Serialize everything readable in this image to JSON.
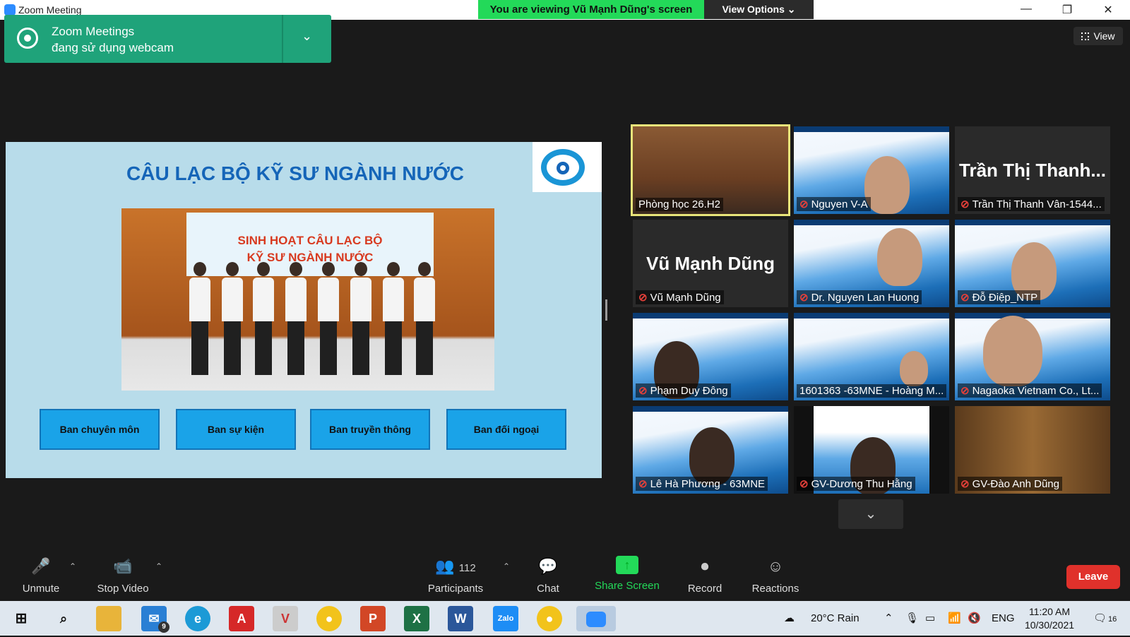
{
  "window": {
    "title": "Zoom Meeting",
    "minimize": "—",
    "restore": "❐",
    "close": "✕"
  },
  "banner": {
    "viewing_text": "You are viewing Vũ Mạnh Dũng's screen",
    "view_options_label": "View Options ⌄"
  },
  "notification": {
    "line1": "Zoom Meetings",
    "line2": "đang sử dụng webcam",
    "chevron": "⌄"
  },
  "view_button": {
    "label": "View"
  },
  "slide": {
    "title": "CÂU LẠC BỘ KỸ SƯ NGÀNH NƯỚC",
    "photo_banner_line1": "SINH HOẠT CÂU LẠC BỘ",
    "photo_banner_line2": "KỸ SƯ NGÀNH NƯỚC",
    "buttons": [
      "Ban chuyên môn",
      "Ban sự kiện",
      "Ban truyền thông",
      "Ban đối ngoại"
    ]
  },
  "participants": [
    {
      "name": "Phòng học 26.H2",
      "muted": false,
      "big_name": ""
    },
    {
      "name": "Nguyen V-A",
      "muted": true,
      "big_name": ""
    },
    {
      "name": "Trần Thị Thanh Vân-1544...",
      "muted": true,
      "big_name": "Trần Thị Thanh..."
    },
    {
      "name": "Vũ Mạnh Dũng",
      "muted": true,
      "big_name": "Vũ Mạnh Dũng"
    },
    {
      "name": "Dr. Nguyen Lan Huong",
      "muted": true,
      "big_name": ""
    },
    {
      "name": "Đỗ Điệp_NTP",
      "muted": true,
      "big_name": ""
    },
    {
      "name": "Phạm Duy Đông",
      "muted": true,
      "big_name": ""
    },
    {
      "name": "1601363 -63MNE - Hoàng M...",
      "muted": false,
      "big_name": ""
    },
    {
      "name": "Nagaoka Vietnam Co., Lt...",
      "muted": true,
      "big_name": ""
    },
    {
      "name": "Lê Hà Phương - 63MNE",
      "muted": true,
      "big_name": ""
    },
    {
      "name": "GV-Dương Thu Hằng",
      "muted": true,
      "big_name": ""
    },
    {
      "name": "GV-Đào Anh Dũng",
      "muted": true,
      "big_name": ""
    }
  ],
  "toolbar": {
    "unmute": "Unmute",
    "stop_video": "Stop Video",
    "participants": "Participants",
    "participant_count": "112",
    "chat": "Chat",
    "share_screen": "Share Screen",
    "record": "Record",
    "reactions": "Reactions",
    "leave": "Leave"
  },
  "taskbar": {
    "weather": "20°C  Rain",
    "language": "ENG",
    "time": "11:20 AM",
    "date": "10/30/2021",
    "mail_badge": "9",
    "notification_count": "16"
  },
  "colors": {
    "zoom_green": "#23d959",
    "toast_green": "#1fa37a",
    "leave_red": "#e0312b",
    "slide_bg": "#b8dcea",
    "slide_title": "#1565b8"
  }
}
